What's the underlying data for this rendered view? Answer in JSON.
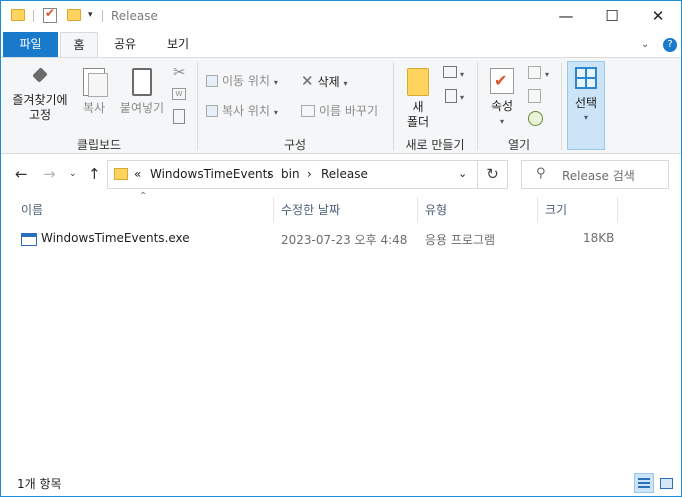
{
  "window": {
    "title": "Release",
    "controls": {
      "minimize": "—",
      "maximize": "☐",
      "close": "✕"
    }
  },
  "ribbon_tabs": [
    "파일",
    "홈",
    "공유",
    "보기"
  ],
  "ribbon": {
    "clipboard": {
      "pin_label_line1": "즐겨찾기에",
      "pin_label_line2": "고정",
      "copy_label": "복사",
      "paste_label": "붙여넣기",
      "group_label": "클립보드"
    },
    "organize": {
      "move_to": "이동 위치",
      "copy_to": "복사 위치",
      "delete": "삭제",
      "rename": "이름 바꾸기",
      "group_label": "구성"
    },
    "new": {
      "new_folder_line1": "새",
      "new_folder_line2": "폴더",
      "group_label": "새로 만들기"
    },
    "open": {
      "properties": "속성",
      "group_label": "열기"
    },
    "select": {
      "label": "선택"
    }
  },
  "address": {
    "overflow": "«",
    "crumbs": [
      "WindowsTimeEvents",
      "bin",
      "Release"
    ],
    "separator": "›"
  },
  "search": {
    "placeholder": "Release 검색"
  },
  "columns": [
    "이름",
    "수정한 날짜",
    "유형",
    "크기"
  ],
  "files": [
    {
      "name": "WindowsTimeEvents.exe",
      "modified": "2023-07-23 오후 4:48",
      "type": "응용 프로그램",
      "size": "18KB",
      "icon": "exe-icon"
    }
  ],
  "status": {
    "item_count": "1개 항목"
  },
  "colors": {
    "accent": "#1979ca",
    "border": "#1a8fd8",
    "selection": "#cce4f7"
  }
}
